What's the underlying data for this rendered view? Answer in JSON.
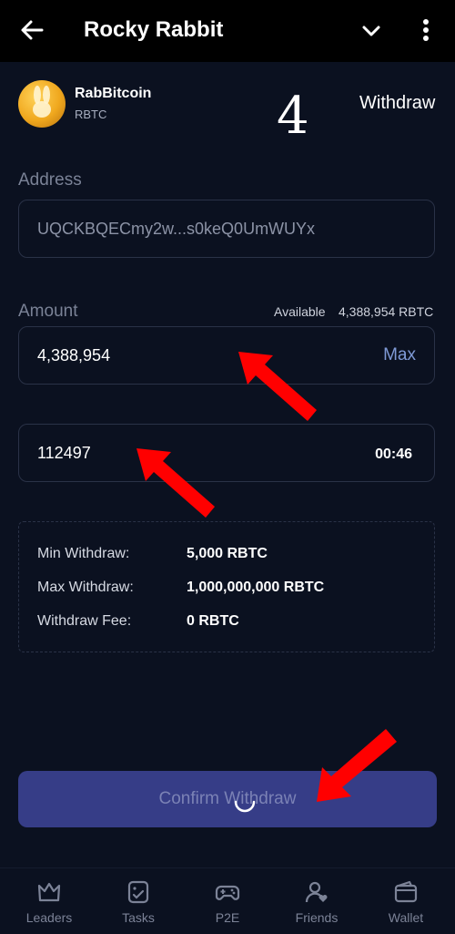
{
  "header": {
    "title": "Rocky Rabbit"
  },
  "coin": {
    "name": "RabBitcoin",
    "symbol": "RBTC"
  },
  "step_number": "4",
  "withdraw_label": "Withdraw",
  "address": {
    "label": "Address",
    "value": "UQCKBQECmy2w...s0keQ0UmWUYx"
  },
  "amount": {
    "label": "Amount",
    "available_label": "Available",
    "available_value": "4,388,954 RBTC",
    "value": "4,388,954",
    "max_label": "Max"
  },
  "code": {
    "value": "112497",
    "timer": "00:46"
  },
  "info": {
    "rows": [
      {
        "key": "Min Withdraw:",
        "value": "5,000 RBTC"
      },
      {
        "key": "Max Withdraw:",
        "value": "1,000,000,000 RBTC"
      },
      {
        "key": "Withdraw Fee:",
        "value": "0 RBTC"
      }
    ]
  },
  "confirm_label": "Confirm Withdraw",
  "tabs": [
    {
      "label": "Leaders",
      "icon": "crown-icon"
    },
    {
      "label": "Tasks",
      "icon": "tasks-icon"
    },
    {
      "label": "P2E",
      "icon": "gamepad-icon"
    },
    {
      "label": "Friends",
      "icon": "friends-icon"
    },
    {
      "label": "Wallet",
      "icon": "wallet-icon"
    }
  ],
  "colors": {
    "background": "#0b1120",
    "topbar": "#000000",
    "button": "#363d87",
    "accent_link": "#7f9ad6",
    "annotation_arrow": "#ff0000"
  }
}
